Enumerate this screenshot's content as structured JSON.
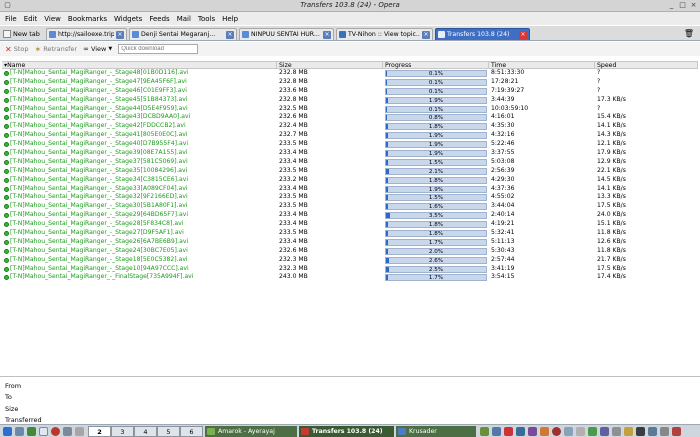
{
  "window": {
    "title": "Transfers 103.8 (24) - Opera"
  },
  "menu": [
    "File",
    "Edit",
    "View",
    "Bookmarks",
    "Widgets",
    "Feeds",
    "Mail",
    "Tools",
    "Help"
  ],
  "tabs": {
    "new_tab_label": "New tab",
    "items": [
      {
        "label": "http://sailoexe.tripod.co..."
      },
      {
        "label": "Denji Sentai Megaranj..."
      },
      {
        "label": "NINPUU SENTAI HUR..."
      },
      {
        "label": "TV-Nihon :: View topic..."
      },
      {
        "label": "Transfers 103.8 (24)",
        "active": true
      }
    ]
  },
  "toolbar": {
    "stop": "Stop",
    "retransfer": "Retransfer",
    "view": "View",
    "search_placeholder": "Quick download"
  },
  "columns": {
    "name": "Name",
    "size": "Size",
    "progress": "Progress",
    "time": "Time",
    "speed": "Speed"
  },
  "transfers": [
    {
      "name": "[T-N]Mahou_Sentai_MagiRanger_-_Stage48[01B0D116].avi",
      "size": "232.8 MB",
      "progress": "0.1%",
      "pct": 0.1,
      "time": "8:51:33:30",
      "speed": "?"
    },
    {
      "name": "[T-N]Mahou_Sentai_MagiRanger_-_Stage47[9EA45F6F].avi",
      "size": "232.8 MB",
      "progress": "0.1%",
      "pct": 0.1,
      "time": "17:28:21",
      "speed": "?"
    },
    {
      "name": "[T-N]Mahou_Sentai_MagiRanger_-_Stage46[C01E9FF3].avi",
      "size": "233.6 MB",
      "progress": "0.1%",
      "pct": 0.1,
      "time": "7:19:39:27",
      "speed": "?"
    },
    {
      "name": "[T-N]Mahou_Sentai_MagiRanger_-_Stage45[51B84373].avi",
      "size": "232.8 MB",
      "progress": "1.9%",
      "pct": 1.9,
      "time": "3:44:39",
      "speed": "17.3 KB/s"
    },
    {
      "name": "[T-N]Mahou_Sentai_MagiRanger_-_Stage44[D5E4F959].avi",
      "size": "232.5 MB",
      "progress": "0.1%",
      "pct": 0.1,
      "time": "10:03:59:10",
      "speed": "?"
    },
    {
      "name": "[T-N]Mahou_Sentai_MagiRanger_-_Stage43[DCBD9AA0].avi",
      "size": "232.6 MB",
      "progress": "0.8%",
      "pct": 0.8,
      "time": "4:16:01",
      "speed": "15.4 KB/s"
    },
    {
      "name": "[T-N]Mahou_Sentai_MagiRanger_-_Stage42[FDDCCB2].avi",
      "size": "232.4 MB",
      "progress": "1.8%",
      "pct": 1.8,
      "time": "4:35:30",
      "speed": "14.1 KB/s"
    },
    {
      "name": "[T-N]Mahou_Sentai_MagiRanger_-_Stage41[805E0E0C].avi",
      "size": "232.7 MB",
      "progress": "1.9%",
      "pct": 1.9,
      "time": "4:32:16",
      "speed": "14.3 KB/s"
    },
    {
      "name": "[T-N]Mahou_Sentai_MagiRanger_-_Stage40[D7B955F4].avi",
      "size": "233.5 MB",
      "progress": "1.9%",
      "pct": 1.9,
      "time": "5:22:46",
      "speed": "12.1 KB/s"
    },
    {
      "name": "[T-N]Mahou_Sentai_MagiRanger_-_Stage39[08E7A155].avi",
      "size": "233.4 MB",
      "progress": "1.9%",
      "pct": 1.9,
      "time": "3:37:55",
      "speed": "17.9 KB/s"
    },
    {
      "name": "[T-N]Mahou_Sentai_MagiRanger_-_Stage37[581C5069].avi",
      "size": "233.4 MB",
      "progress": "1.5%",
      "pct": 1.5,
      "time": "5:03:08",
      "speed": "12.9 KB/s"
    },
    {
      "name": "[T-N]Mahou_Sentai_MagiRanger_-_Stage35[10084296].avi",
      "size": "233.5 MB",
      "progress": "2.1%",
      "pct": 2.1,
      "time": "2:56:39",
      "speed": "22.1 KB/s"
    },
    {
      "name": "[T-N]Mahou_Sentai_MagiRanger_-_Stage34[C3815CE6].avi",
      "size": "233.2 MB",
      "progress": "1.8%",
      "pct": 1.8,
      "time": "4:29:30",
      "speed": "14.5 KB/s"
    },
    {
      "name": "[T-N]Mahou_Sentai_MagiRanger_-_Stage33[A089CF04].avi",
      "size": "233.4 MB",
      "progress": "1.9%",
      "pct": 1.9,
      "time": "4:37:36",
      "speed": "14.1 KB/s"
    },
    {
      "name": "[T-N]Mahou_Sentai_MagiRanger_-_Stage32[9F2166ED].avi",
      "size": "233.5 MB",
      "progress": "1.5%",
      "pct": 1.5,
      "time": "4:55:02",
      "speed": "13.3 KB/s"
    },
    {
      "name": "[T-N]Mahou_Sentai_MagiRanger_-_Stage30[5B1A80F1].avi",
      "size": "233.5 MB",
      "progress": "1.6%",
      "pct": 1.6,
      "time": "3:44:04",
      "speed": "17.5 KB/s"
    },
    {
      "name": "[T-N]Mahou_Sentai_MagiRanger_-_Stage29[64BD65F7].avi",
      "size": "233.4 MB",
      "progress": "3.5%",
      "pct": 3.5,
      "time": "2:40:14",
      "speed": "24.0 KB/s"
    },
    {
      "name": "[T-N]Mahou_Sentai_MagiRanger_-_Stage28[5F834C8].avi",
      "size": "233.4 MB",
      "progress": "1.8%",
      "pct": 1.8,
      "time": "4:19:21",
      "speed": "15.1 KB/s"
    },
    {
      "name": "[T-N]Mahou_Sentai_MagiRanger_-_Stage27[D9F5AF1].avi",
      "size": "233.5 MB",
      "progress": "1.8%",
      "pct": 1.8,
      "time": "5:32:41",
      "speed": "11.8 KB/s"
    },
    {
      "name": "[T-N]Mahou_Sentai_MagiRanger_-_Stage26[6A7BE6B9].avi",
      "size": "233.4 MB",
      "progress": "1.7%",
      "pct": 1.7,
      "time": "5:11:13",
      "speed": "12.6 KB/s"
    },
    {
      "name": "[T-N]Mahou_Sentai_MagiRanger_-_Stage24[30BC7E05].avi",
      "size": "232.6 MB",
      "progress": "2.0%",
      "pct": 2.0,
      "time": "5:30:43",
      "speed": "11.8 KB/s"
    },
    {
      "name": "[T-N]Mahou_Sentai_MagiRanger_-_Stage18[5E0C5382].avi",
      "size": "232.3 MB",
      "progress": "2.6%",
      "pct": 2.6,
      "time": "2:57:44",
      "speed": "21.7 KB/s"
    },
    {
      "name": "[T-N]Mahou_Sentai_MagiRanger_-_Stage10[94A97CCC].avi",
      "size": "232.3 MB",
      "progress": "2.5%",
      "pct": 2.5,
      "time": "3:41:19",
      "speed": "17.5 KB/s"
    },
    {
      "name": "[T-N]Mahou_Sentai_MagiRanger_-_FinalStage[735A994F].avi",
      "size": "243.0 MB",
      "progress": "1.7%",
      "pct": 1.7,
      "time": "3:54:15",
      "speed": "17.4 KB/s"
    }
  ],
  "details": {
    "from": "From",
    "to": "To",
    "size": "Size",
    "transferred": "Transferred"
  },
  "taskbar": {
    "desktops": [
      "2",
      "3",
      "4",
      "5",
      "6"
    ],
    "tasks": [
      {
        "label": "Amarok - Ayerayaj"
      },
      {
        "label": "Transfers 103.8 (24)",
        "active": true
      },
      {
        "label": "Krusader"
      }
    ]
  },
  "colors": {
    "accent": "#3f6fc4",
    "progress_fill": "#2b68c8",
    "filename": "#1c9a1c"
  }
}
